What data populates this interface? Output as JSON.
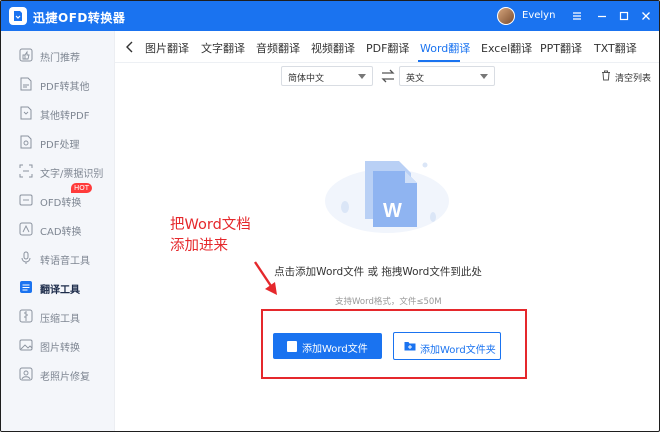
{
  "titlebar": {
    "title": "迅捷OFD转换器",
    "username": "Evelyn",
    "icons": [
      "menu-icon",
      "minimize-icon",
      "restore-icon",
      "close-icon"
    ]
  },
  "sidebar": {
    "items": [
      {
        "label": "热门推荐",
        "icon": "thumbs-up-icon"
      },
      {
        "label": "PDF转其他",
        "icon": "pdf-convert-icon"
      },
      {
        "label": "其他转PDF",
        "icon": "to-pdf-icon"
      },
      {
        "label": "PDF处理",
        "icon": "pdf-process-icon"
      },
      {
        "label": "文字/票据识别",
        "icon": "ocr-icon"
      },
      {
        "label": "OFD转换",
        "icon": "ofd-icon",
        "badge": "HOT"
      },
      {
        "label": "CAD转换",
        "icon": "cad-icon"
      },
      {
        "label": "转语音工具",
        "icon": "voice-icon"
      },
      {
        "label": "翻译工具",
        "icon": "translate-icon",
        "active": true
      },
      {
        "label": "压缩工具",
        "icon": "compress-icon"
      },
      {
        "label": "图片转换",
        "icon": "image-icon"
      },
      {
        "label": "老照片修复",
        "icon": "photo-repair-icon"
      }
    ]
  },
  "tabs": [
    "图片翻译",
    "文字翻译",
    "音频翻译",
    "视频翻译",
    "PDF翻译",
    "Word翻译",
    "Excel翻译",
    "PPT翻译",
    "TXT翻译"
  ],
  "active_tab": "Word翻译",
  "language": {
    "source": "简体中文",
    "target": "英文"
  },
  "clear_list": "清空列表",
  "main": {
    "hint": "点击添加Word文件 或 拖拽Word文件到此处",
    "support": "支持Word格式，文件≤50M",
    "add_file": "添加Word文件",
    "add_folder": "添加Word文件夹"
  },
  "annotation": {
    "line1": "把Word文档",
    "line2": "添加进来"
  },
  "colors": {
    "accent": "#1a73f0",
    "annotation": "#e5282c",
    "hot": "#ff3b3b"
  }
}
